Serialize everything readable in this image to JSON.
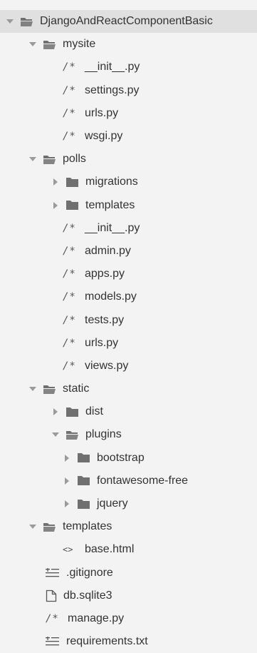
{
  "explorer": {
    "rows": [
      {
        "label": "DjangoAndReactComponentBasic",
        "type": "folder",
        "expanded": true,
        "depth": 0,
        "icon": "folder-open-icon"
      },
      {
        "label": "mysite",
        "type": "folder",
        "expanded": true,
        "depth": 1,
        "icon": "folder-open-icon"
      },
      {
        "label": "__init__.py",
        "type": "file",
        "depth": 2,
        "icon": "code-comment-icon"
      },
      {
        "label": "settings.py",
        "type": "file",
        "depth": 2,
        "icon": "code-comment-icon"
      },
      {
        "label": "urls.py",
        "type": "file",
        "depth": 2,
        "icon": "code-comment-icon"
      },
      {
        "label": "wsgi.py",
        "type": "file",
        "depth": 2,
        "icon": "code-comment-icon"
      },
      {
        "label": "polls",
        "type": "folder",
        "expanded": true,
        "depth": 1,
        "icon": "folder-open-icon"
      },
      {
        "label": "migrations",
        "type": "folder",
        "expanded": false,
        "depth": 2,
        "icon": "folder-icon"
      },
      {
        "label": "templates",
        "type": "folder",
        "expanded": false,
        "depth": 2,
        "icon": "folder-icon"
      },
      {
        "label": "__init__.py",
        "type": "file",
        "depth": 3,
        "icon": "code-comment-icon"
      },
      {
        "label": "admin.py",
        "type": "file",
        "depth": 3,
        "icon": "code-comment-icon"
      },
      {
        "label": "apps.py",
        "type": "file",
        "depth": 3,
        "icon": "code-comment-icon"
      },
      {
        "label": "models.py",
        "type": "file",
        "depth": 3,
        "icon": "code-comment-icon"
      },
      {
        "label": "tests.py",
        "type": "file",
        "depth": 3,
        "icon": "code-comment-icon"
      },
      {
        "label": "urls.py",
        "type": "file",
        "depth": 3,
        "icon": "code-comment-icon"
      },
      {
        "label": "views.py",
        "type": "file",
        "depth": 3,
        "icon": "code-comment-icon"
      },
      {
        "label": "static",
        "type": "folder",
        "expanded": true,
        "depth": 1,
        "icon": "folder-open-icon"
      },
      {
        "label": "dist",
        "type": "folder",
        "expanded": false,
        "depth": 2,
        "icon": "folder-icon"
      },
      {
        "label": "plugins",
        "type": "folder",
        "expanded": true,
        "depth": 2,
        "icon": "folder-open-icon"
      },
      {
        "label": "bootstrap",
        "type": "folder",
        "expanded": false,
        "depth": 3,
        "icon": "folder-icon"
      },
      {
        "label": "fontawesome-free",
        "type": "folder",
        "expanded": false,
        "depth": 3,
        "icon": "folder-icon"
      },
      {
        "label": "jquery",
        "type": "folder",
        "expanded": false,
        "depth": 3,
        "icon": "folder-icon"
      },
      {
        "label": "templates",
        "type": "folder",
        "expanded": true,
        "depth": 1,
        "icon": "folder-open-icon"
      },
      {
        "label": "base.html",
        "type": "file",
        "depth": 2,
        "icon": "html-brackets-icon"
      },
      {
        "label": ".gitignore",
        "type": "file",
        "depth": 1,
        "icon": "text-lines-icon"
      },
      {
        "label": "db.sqlite3",
        "type": "file",
        "depth": 1,
        "icon": "document-icon"
      },
      {
        "label": "manage.py",
        "type": "file",
        "depth": 1,
        "icon": "code-comment-icon"
      },
      {
        "label": "requirements.txt",
        "type": "file",
        "depth": 1,
        "icon": "text-lines-icon"
      }
    ]
  },
  "colors": {
    "background": "#f3f3f3",
    "root_highlight": "#e0e0e0",
    "text": "#333333",
    "folder": "#707070",
    "arrow": "#9a9a9a"
  }
}
